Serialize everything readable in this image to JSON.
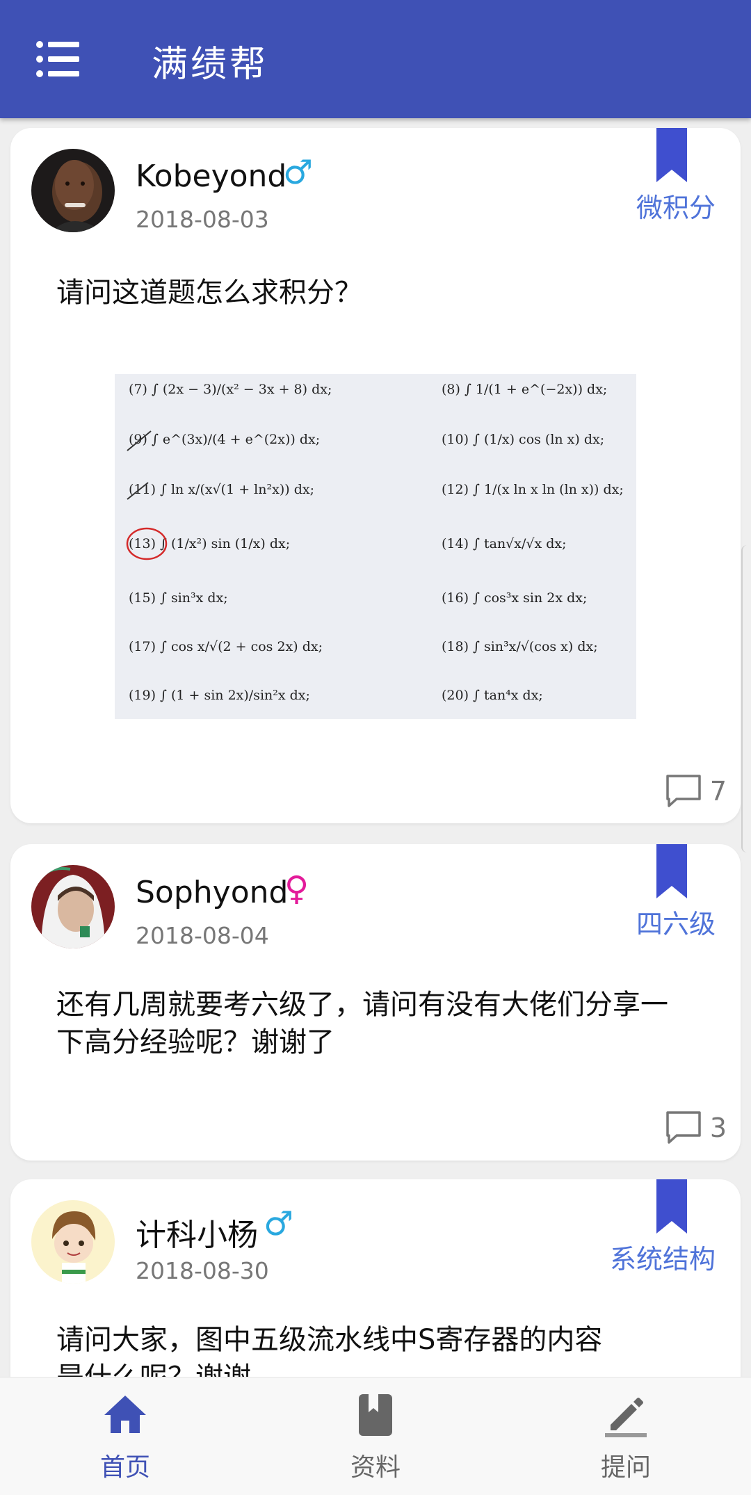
{
  "app": {
    "title": "满绩帮",
    "menu_icon": "hamburger-menu-icon",
    "brand_color": "#3f51b5"
  },
  "posts": [
    {
      "username": "Kobeyond",
      "gender_symbol": "♂",
      "date": "2018-08-03",
      "category": "微积分",
      "text": "请问这道题怎么求积分？",
      "comment_count": "7",
      "image": {
        "items": [
          "(7) ∫ (2x − 3)/(x² − 3x + 8) dx;",
          "(8) ∫ 1/(1 + e^(−2x)) dx;",
          "(9) ∫ e^(3x)/(4 + e^(2x)) dx;",
          "(10) ∫ (1/x) cos (ln x) dx;",
          "(11) ∫ ln x/(x√(1 + ln²x)) dx;",
          "(12) ∫ 1/(x ln x ln (ln x)) dx;",
          "(13) ∫ (1/x²) sin (1/x) dx;",
          "(14) ∫ tan√x/√x dx;",
          "(15) ∫ sin³x dx;",
          "(16) ∫ cos³x sin 2x dx;",
          "(17) ∫ cos x/√(2 + cos 2x) dx;",
          "(18) ∫ sin³x/√(cos x) dx;",
          "(19) ∫ (1 + sin 2x)/sin²x dx;",
          "(20) ∫ tan⁴x dx;"
        ]
      }
    },
    {
      "username": "Sophyond",
      "gender_symbol": "♀",
      "date": "2018-08-04",
      "category": "四六级",
      "text": "还有几周就要考六级了，请问有没有大佬们分享一下高分经验呢？谢谢了",
      "comment_count": "3"
    },
    {
      "username": "计科小杨",
      "gender_symbol": "♂",
      "date": "2018-08-30",
      "category": "系统结构",
      "text": "请问大家，图中五级流水线中S寄存器的内容是什么呢？谢谢"
    }
  ],
  "nav": [
    {
      "label": "首页",
      "icon": "home-icon",
      "active": true
    },
    {
      "label": "资料",
      "icon": "book-icon",
      "active": false
    },
    {
      "label": "提问",
      "icon": "edit-pencil-icon",
      "active": false
    }
  ],
  "colors": {
    "male": "#29a8df",
    "female": "#e31b9a",
    "category": "#4f73d9",
    "bookmark": "#3f51b5",
    "nav_active": "#3f51b5"
  }
}
